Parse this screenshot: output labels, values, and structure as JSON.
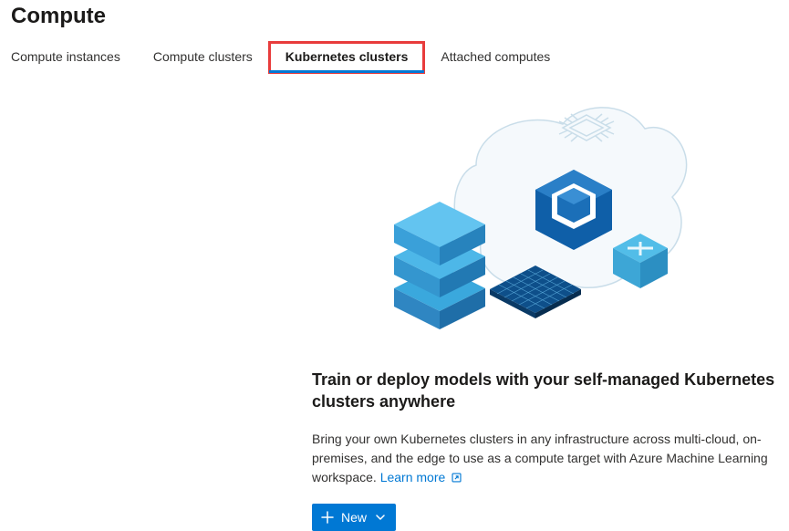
{
  "page": {
    "title": "Compute"
  },
  "tabs": {
    "t0": "Compute instances",
    "t1": "Compute clusters",
    "t2": "Kubernetes clusters",
    "t3": "Attached computes"
  },
  "hero": {
    "heading": "Train or deploy models with your self-managed Kubernetes clusters anywhere",
    "description": "Bring your own Kubernetes clusters in any infrastructure across multi-cloud, on-premises, and the edge to use as a compute target with Azure Machine Learning workspace. ",
    "learn_more": "Learn more",
    "new_button": "New"
  },
  "colors": {
    "primary": "#0078d4",
    "highlight": "#e83c3c"
  }
}
